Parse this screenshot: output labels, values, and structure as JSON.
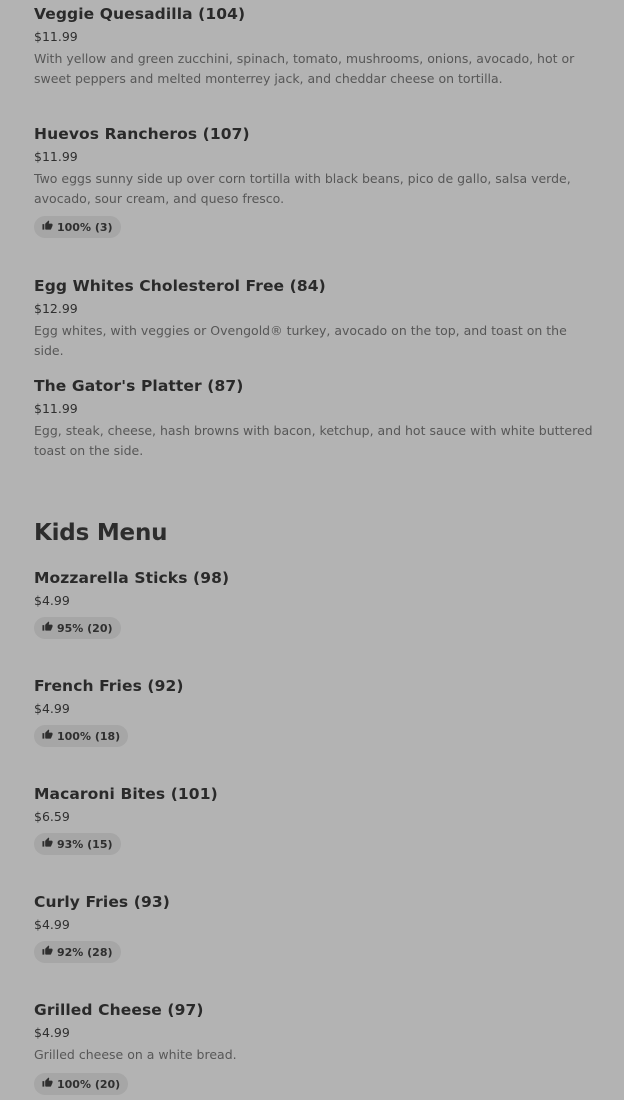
{
  "items_top": [
    {
      "title": "Veggie Quesadilla (104)",
      "price": "$11.99",
      "description": "With yellow and green zucchini, spinach, tomato, mushrooms, onions, avocado, hot or sweet peppers and melted monterrey jack, and cheddar cheese on tortilla."
    },
    {
      "title": "Huevos Rancheros (107)",
      "price": "$11.99",
      "description": "Two eggs sunny side up over corn tortilla with black beans, pico de gallo, salsa verde, avocado, sour cream, and queso fresco.",
      "rating": "100% (3)"
    },
    {
      "title": "Egg Whites Cholesterol Free (84)",
      "price": "$12.99",
      "description": "Egg whites, with veggies or Ovengold® turkey, avocado on the top, and toast on the side."
    },
    {
      "title": "The Gator's Platter (87)",
      "price": "$11.99",
      "description": "Egg, steak, cheese, hash browns with bacon, ketchup, and hot sauce with white buttered toast on the side."
    }
  ],
  "kids_section": {
    "heading": "Kids Menu",
    "items": [
      {
        "title": "Mozzarella Sticks (98)",
        "price": "$4.99",
        "rating": "95% (20)"
      },
      {
        "title": "French Fries (92)",
        "price": "$4.99",
        "rating": "100% (18)"
      },
      {
        "title": "Macaroni Bites (101)",
        "price": "$6.59",
        "rating": "93% (15)"
      },
      {
        "title": "Curly Fries (93)",
        "price": "$4.99",
        "rating": "92% (28)"
      },
      {
        "title": "Grilled Cheese (97)",
        "price": "$4.99",
        "description": "Grilled cheese on a white bread.",
        "rating": "100% (20)"
      }
    ]
  },
  "icons": {
    "rating": "thumbs-up-icon"
  }
}
